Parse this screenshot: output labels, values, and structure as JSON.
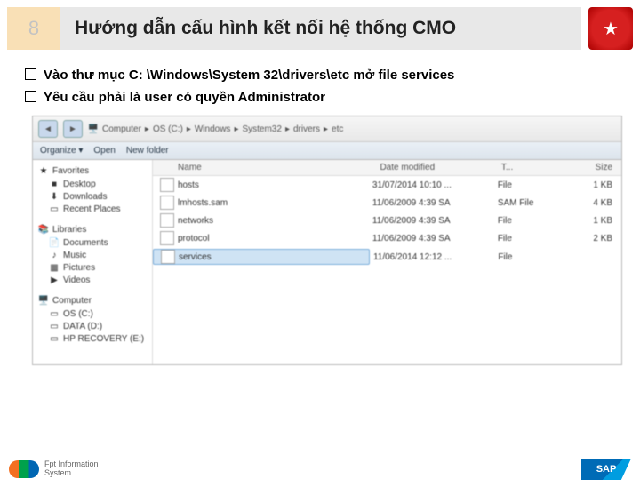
{
  "header": {
    "slide_number": "8",
    "title": "Hướng dẫn cấu hình kết nối hệ thống CMO"
  },
  "bullets": [
    "Vào thư mục C: \\Windows\\System 32\\drivers\\etc mở file services",
    "Yêu cầu phải là user có quyền Administrator"
  ],
  "explorer": {
    "breadcrumb": [
      "Computer",
      "OS (C:)",
      "Windows",
      "System32",
      "drivers",
      "etc"
    ],
    "toolbar": {
      "organize": "Organize ▾",
      "open": "Open",
      "newfolder": "New folder"
    },
    "nav": {
      "favorites": {
        "label": "Favorites",
        "items": [
          "Desktop",
          "Downloads",
          "Recent Places"
        ]
      },
      "libraries": {
        "label": "Libraries",
        "items": [
          "Documents",
          "Music",
          "Pictures",
          "Videos"
        ]
      },
      "computer": {
        "label": "Computer",
        "items": [
          "OS (C:)",
          "DATA (D:)",
          "HP RECOVERY (E:)"
        ]
      }
    },
    "columns": {
      "name": "Name",
      "date": "Date modified",
      "type": "T...",
      "size": "Size"
    },
    "files": [
      {
        "name": "hosts",
        "date": "31/07/2014 10:10 ...",
        "type": "File",
        "size": "1 KB",
        "selected": false
      },
      {
        "name": "lmhosts.sam",
        "date": "11/06/2009 4:39 SA",
        "type": "SAM File",
        "size": "4 KB",
        "selected": false
      },
      {
        "name": "networks",
        "date": "11/06/2009 4:39 SA",
        "type": "File",
        "size": "1 KB",
        "selected": false
      },
      {
        "name": "protocol",
        "date": "11/06/2009 4:39 SA",
        "type": "File",
        "size": "2 KB",
        "selected": false
      },
      {
        "name": "services",
        "date": "11/06/2014 12:12 ...",
        "type": "File",
        "size": "",
        "selected": true
      }
    ]
  },
  "footer": {
    "fpt": "Fpt Information\nSystem",
    "sap": "SAP"
  }
}
